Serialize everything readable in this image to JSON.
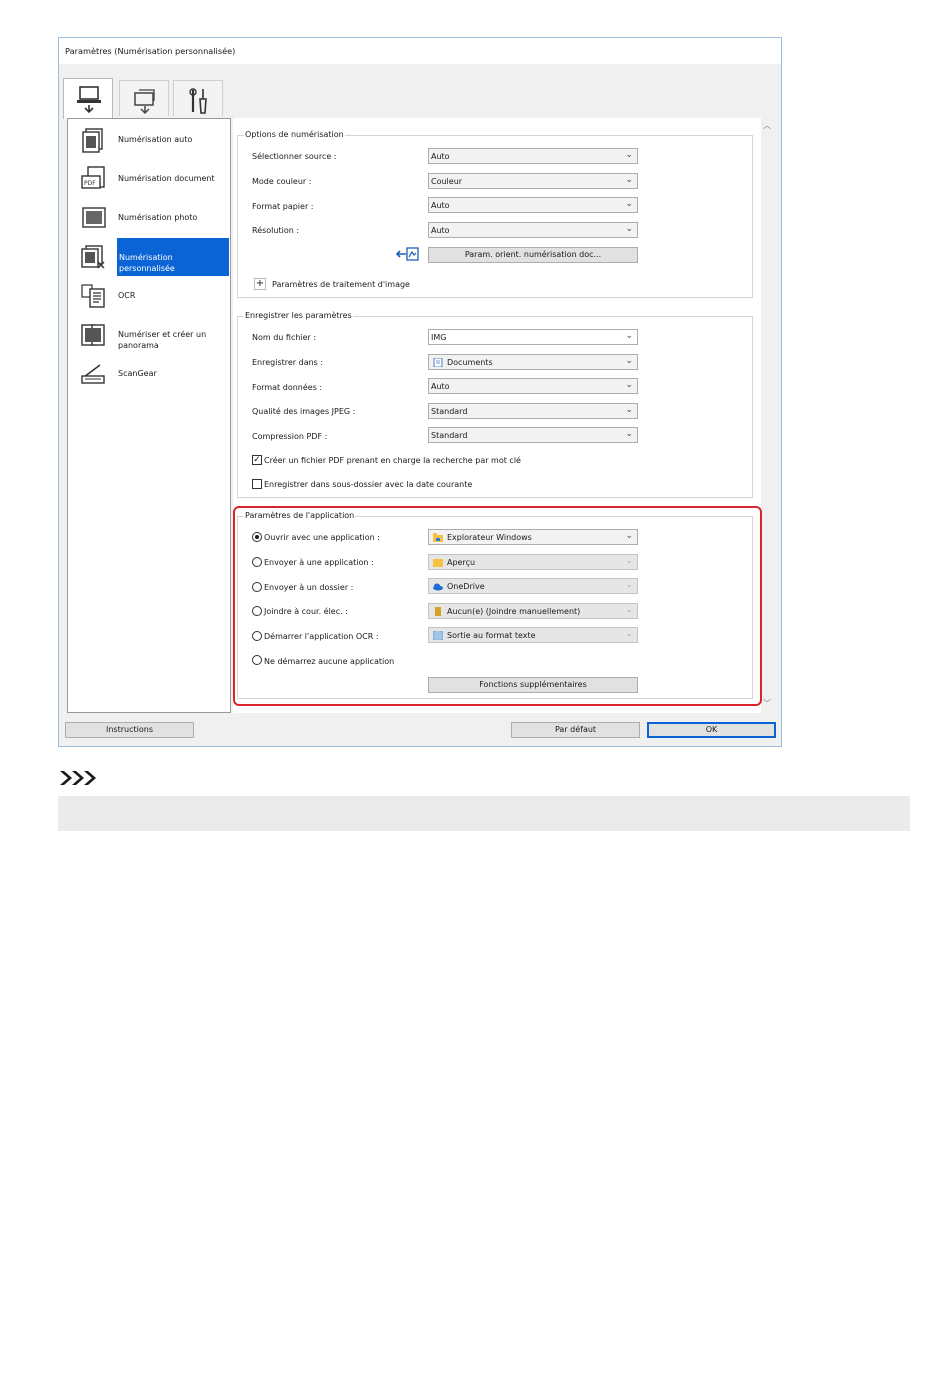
{
  "window": {
    "title": "Paramètres (Numérisation personnalisée)"
  },
  "tabs": [
    {
      "icon": "computer-scan-icon",
      "active": true
    },
    {
      "icon": "scanner-to-pc-icon",
      "active": false
    },
    {
      "icon": "tools-icon",
      "active": false
    }
  ],
  "sidebar": {
    "items": [
      {
        "label": "Numérisation auto",
        "icon": "auto-scan-icon",
        "selected": false
      },
      {
        "label": "Numérisation document",
        "icon": "document-scan-icon",
        "selected": false
      },
      {
        "label": "Numérisation photo",
        "icon": "photo-scan-icon",
        "selected": false
      },
      {
        "label": "Numérisation personnalisée",
        "icon": "custom-scan-icon",
        "selected": true
      },
      {
        "label": "OCR",
        "icon": "ocr-icon",
        "selected": false
      },
      {
        "label": "Numériser et créer un panorama",
        "icon": "panorama-icon",
        "selected": false
      },
      {
        "label": "ScanGear",
        "icon": "scangear-icon",
        "selected": false
      }
    ]
  },
  "scan_options": {
    "title": "Options de numérisation",
    "source_label": "Sélectionner source :",
    "source_value": "Auto",
    "color_label": "Mode couleur :",
    "color_value": "Couleur",
    "paper_label": "Format papier :",
    "paper_value": "Auto",
    "resolution_label": "Résolution :",
    "resolution_value": "Auto",
    "orientation_button": "Param. orient. numérisation doc...",
    "image_processing_label": "Paramètres de traitement d'image"
  },
  "save_settings": {
    "title": "Enregistrer les paramètres",
    "filename_label": "Nom du fichier :",
    "filename_value": "IMG",
    "save_in_label": "Enregistrer dans :",
    "save_in_value": "Documents",
    "data_format_label": "Format données :",
    "data_format_value": "Auto",
    "jpeg_label": "Qualité des images JPEG :",
    "jpeg_value": "Standard",
    "pdf_label": "Compression PDF :",
    "pdf_value": "Standard",
    "searchable_pdf_label": "Créer un fichier PDF prenant en charge la recherche par mot clé",
    "searchable_pdf_checked": true,
    "subfolder_label": "Enregistrer dans sous-dossier avec la date courante",
    "subfolder_checked": false
  },
  "app_settings": {
    "title": "Paramètres de l'application",
    "options": [
      {
        "label": "Ouvrir avec une application :",
        "value": "Explorateur Windows",
        "checked": true,
        "enabled": true,
        "icon": "explorer-icon"
      },
      {
        "label": "Envoyer à une application :",
        "value": "Aperçu",
        "checked": false,
        "enabled": false,
        "icon": "folder-icon"
      },
      {
        "label": "Envoyer à un dossier :",
        "value": "OneDrive",
        "checked": false,
        "enabled": false,
        "icon": "onedrive-icon"
      },
      {
        "label": "Joindre à cour. élec. :",
        "value": "Aucun(e) (Joindre manuellement)",
        "checked": false,
        "enabled": false,
        "icon": "mail-attach-icon"
      },
      {
        "label": "Démarrer l'application OCR :",
        "value": "Sortie au format texte",
        "checked": false,
        "enabled": false,
        "icon": "text-file-icon"
      }
    ],
    "no_app_label": "Ne démarrez aucune application",
    "more_functions_button": "Fonctions supplémentaires"
  },
  "footer": {
    "instructions_button": "Instructions",
    "defaults_button": "Par défaut",
    "ok_button": "OK"
  },
  "colors": {
    "selection": "#0a64d6",
    "highlight": "#d9242b"
  }
}
